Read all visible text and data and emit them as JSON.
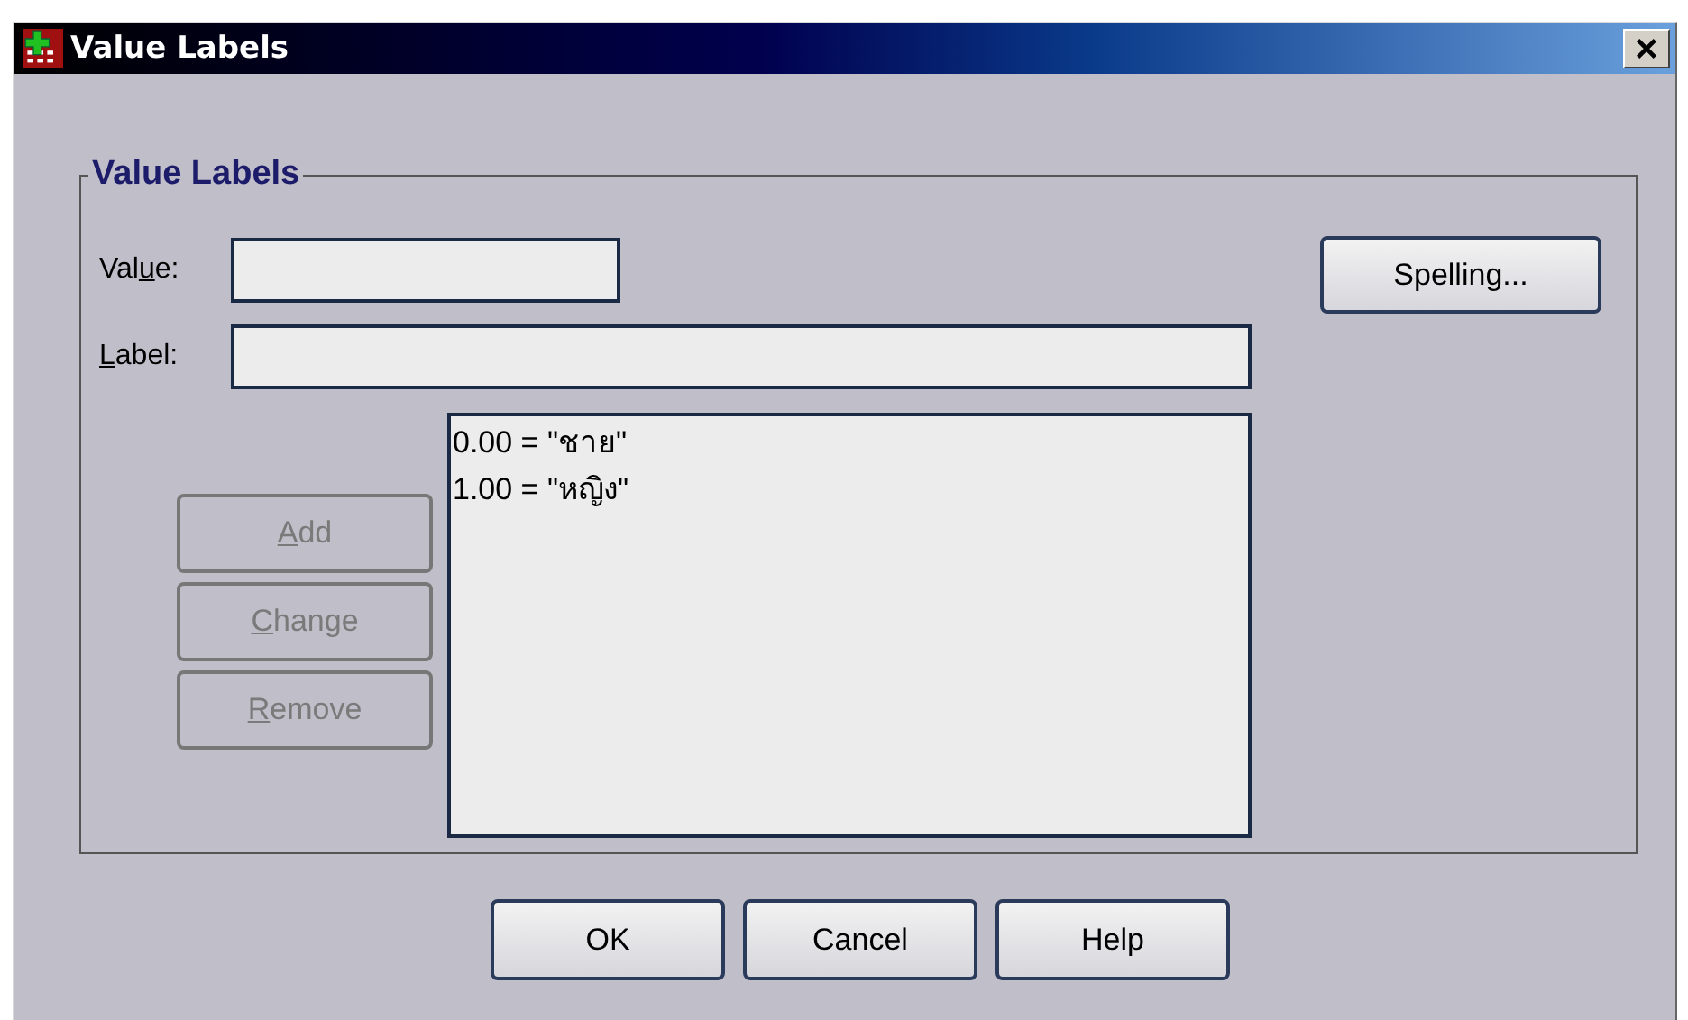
{
  "window": {
    "title": "Value Labels"
  },
  "group": {
    "title": "Value Labels"
  },
  "fields": [
    {
      "kind": "short",
      "label": {
        "pre": "Val",
        "key": "u",
        "post": "e:"
      }
    },
    {
      "kind": "long",
      "label": {
        "key": "L",
        "post": "abel:"
      }
    }
  ],
  "spelling_button": {
    "label": "Spelling..."
  },
  "side_buttons": [
    {
      "label": {
        "key": "A",
        "post": "dd"
      },
      "disabled": true
    },
    {
      "label": {
        "key": "C",
        "post": "hange"
      },
      "disabled": true
    },
    {
      "label": {
        "key": "R",
        "post": "emove"
      },
      "disabled": true
    }
  ],
  "list_items": [
    "0.00 = \"ชาย\"",
    "1.00 = \"หญิง\""
  ],
  "buttons": [
    "OK",
    "Cancel",
    "Help"
  ]
}
